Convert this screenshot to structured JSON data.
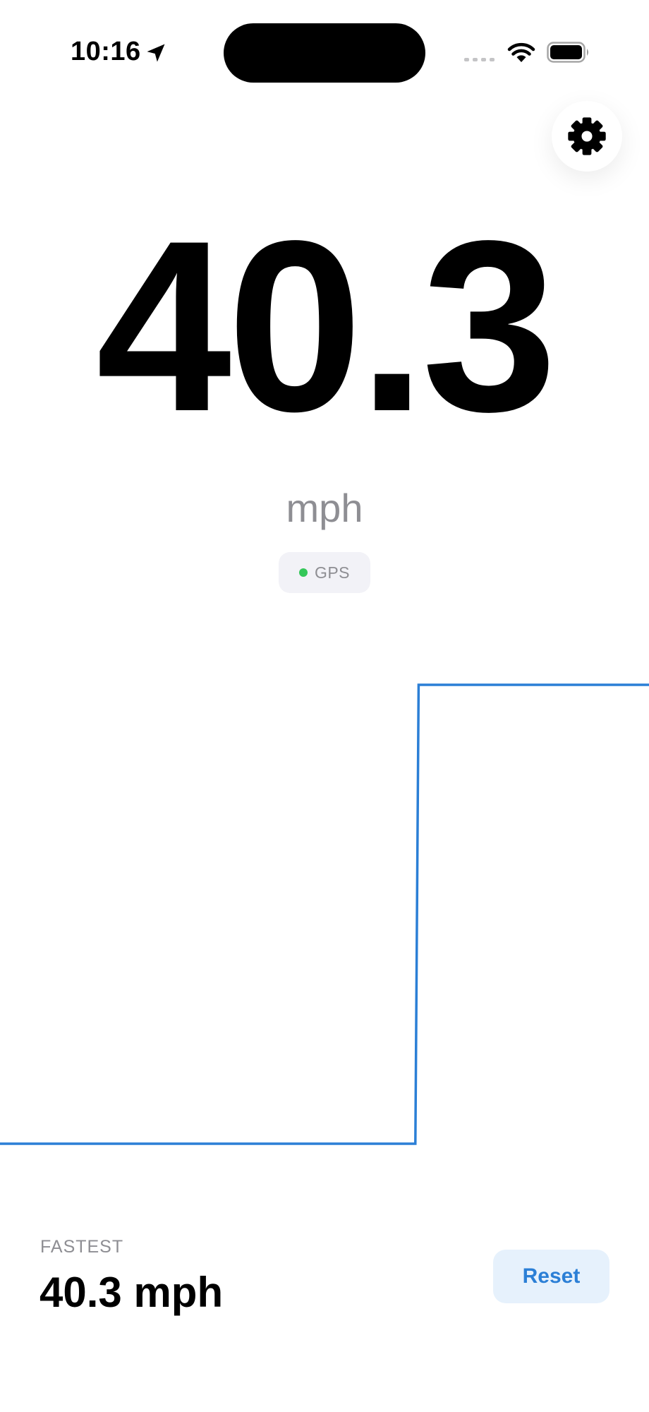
{
  "status_bar": {
    "time": "10:16",
    "location_icon": "location-arrow-icon",
    "wifi_icon": "wifi-icon",
    "battery_icon": "battery-icon"
  },
  "settings": {
    "icon": "gear-icon"
  },
  "speed": {
    "value": "40.3",
    "unit": "mph"
  },
  "gps": {
    "label": "GPS",
    "status_color": "#34c759"
  },
  "chart_data": {
    "type": "line",
    "title": "",
    "xlabel": "",
    "ylabel": "",
    "step": true,
    "grid": false,
    "line_color": "#2b7fd6",
    "series": [
      {
        "x": [
          0,
          0.64,
          0.645,
          1.0
        ],
        "y": [
          0,
          0,
          40.3,
          40.3
        ]
      }
    ],
    "xlim": [
      0,
      1
    ],
    "ylim": [
      0,
      40.3
    ]
  },
  "fastest": {
    "label": "FASTEST",
    "value": "40.3 mph"
  },
  "reset_label": "Reset",
  "accent_color": "#2b7fd6"
}
